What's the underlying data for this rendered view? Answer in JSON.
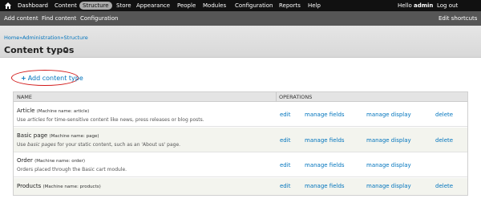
{
  "toolbar": {
    "items": [
      "Dashboard",
      "Content",
      "Structure",
      "Store",
      "Appearance",
      "People",
      "Modules",
      "Configuration",
      "Reports",
      "Help"
    ],
    "active": "Structure",
    "hello_prefix": "Hello",
    "user": "admin",
    "logout": "Log out"
  },
  "shortcuts": {
    "items": [
      "Add content",
      "Find content",
      "Configuration"
    ],
    "edit": "Edit shortcuts"
  },
  "breadcrumb": {
    "home": "Home",
    "sep1": "»",
    "admin": "Administration",
    "sep2": "»",
    "structure": "Structure"
  },
  "page_title": "Content types",
  "add_link": {
    "plus": "+",
    "label": "Add content type"
  },
  "table": {
    "headers": {
      "name": "NAME",
      "operations": "OPERATIONS"
    },
    "rows": [
      {
        "name": "Article",
        "machine": "(Machine name: article)",
        "desc_pre": "Use ",
        "desc_em": "articles",
        "desc_post": " for time-sensitive content like news, press releases or blog posts.",
        "ops": [
          "edit",
          "manage fields",
          "manage display",
          "delete"
        ]
      },
      {
        "name": "Basic page",
        "machine": "(Machine name: page)",
        "desc_pre": "Use ",
        "desc_em": "basic pages",
        "desc_post": " for your static content, such as an 'About us' page.",
        "ops": [
          "edit",
          "manage fields",
          "manage display",
          "delete"
        ]
      },
      {
        "name": "Order",
        "machine": "(Machine name: order)",
        "desc_pre": "Orders placed through the Basic cart module.",
        "desc_em": "",
        "desc_post": "",
        "ops": [
          "edit",
          "manage fields",
          "manage display"
        ]
      },
      {
        "name": "Products",
        "machine": "(Machine name: products)",
        "desc_pre": "",
        "desc_em": "",
        "desc_post": "",
        "ops": [
          "edit",
          "manage fields",
          "manage display",
          "delete"
        ]
      }
    ]
  },
  "icons": {
    "home": "home-icon",
    "gear": "gear-icon"
  },
  "colors": {
    "link": "#0074bd",
    "toolbar": "#111111",
    "shortcut_bar": "#565656",
    "highlight_circle": "#d21a1a"
  }
}
